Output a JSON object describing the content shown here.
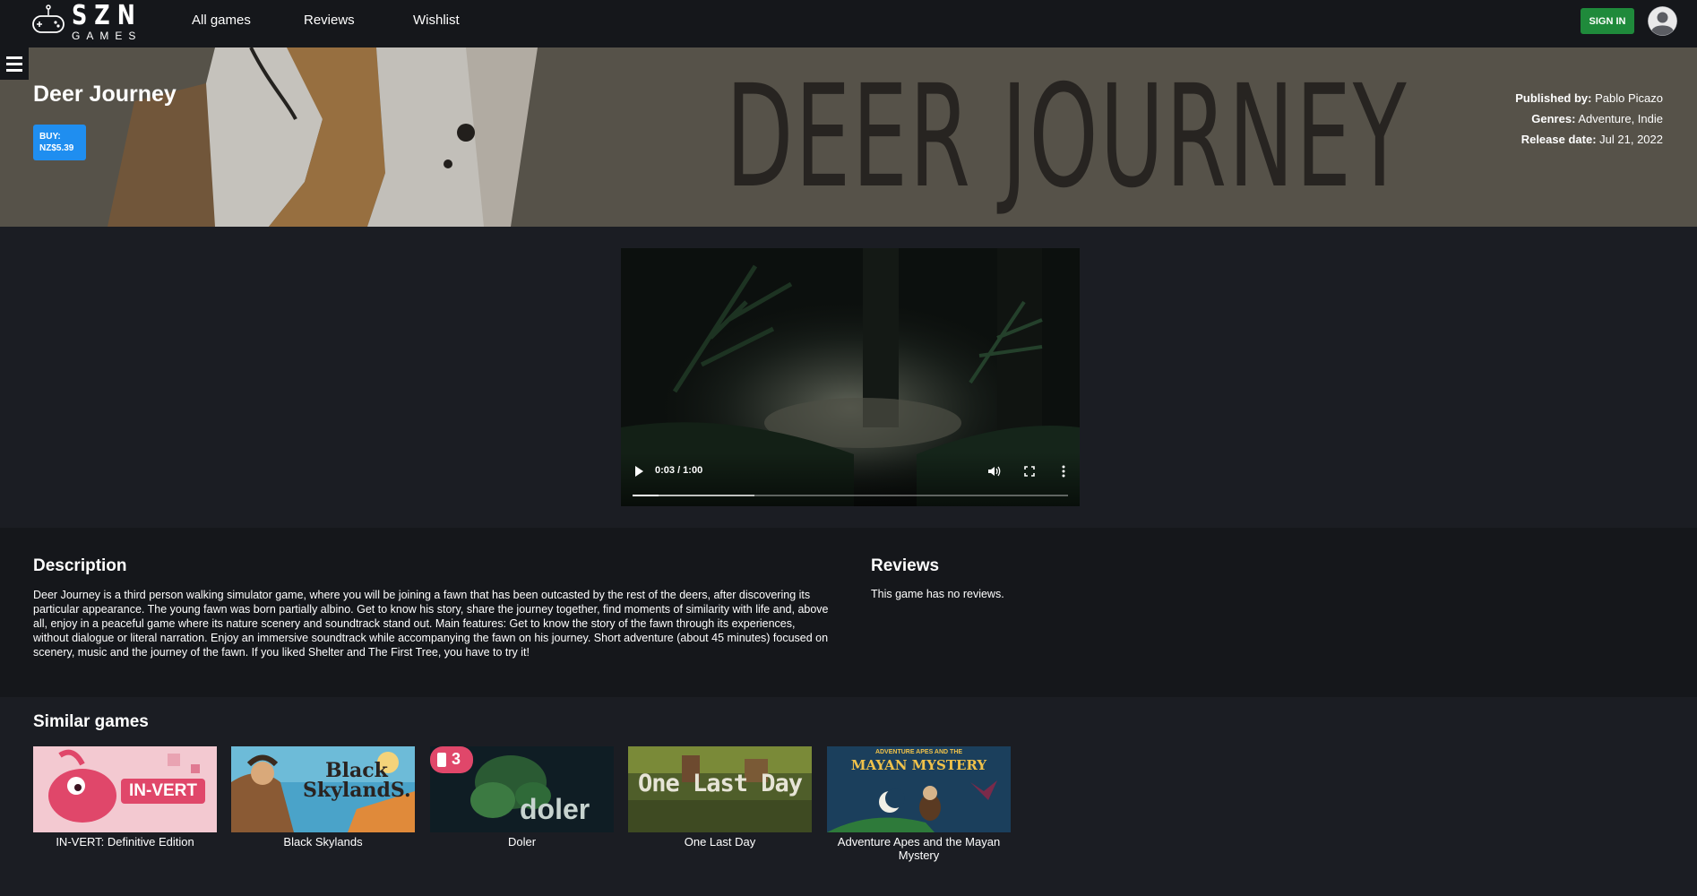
{
  "nav": {
    "logo_text": "SZN",
    "logo_sub": "GAMES",
    "links": [
      "All games",
      "Reviews",
      "Wishlist"
    ],
    "sign_in": "SIGN IN"
  },
  "hero": {
    "title": "Deer Journey",
    "buy_line1": "BUY:",
    "buy_line2": "NZ$5.39",
    "banner_text": "DEER JOURNEY",
    "published_label": "Published by:",
    "published_value": "Pablo Picazo",
    "genres_label": "Genres:",
    "genres_value": "Adventure, Indie",
    "release_label": "Release date:",
    "release_value": "Jul 21, 2022"
  },
  "video": {
    "time": "0:03 / 1:00",
    "progress": 0.06,
    "buffered": 0.28
  },
  "description": {
    "heading": "Description",
    "text": "Deer Journey is a third person walking simulator game, where you will be joining a fawn that has been outcasted by the rest of the deers, after discovering its particular appearance. The young fawn was born partially albino. Get to know his story, share the journey together, find moments of similarity with life and, above all, enjoy in a peaceful game where its nature scenery and soundtrack stand out. Main features: Get to know the story of the fawn through its experiences, without dialogue or literal narration. Enjoy an immersive soundtrack while accompanying the fawn on his journey. Short adventure (about 45 minutes) focused on scenery, music and the journey of the fawn. If you liked Shelter and The First Tree, you have to try it!"
  },
  "reviews": {
    "heading": "Reviews",
    "empty": "This game has no reviews."
  },
  "similar": {
    "heading": "Similar games",
    "games": [
      {
        "title": "IN-VERT: Definitive Edition",
        "art": "IN-VERT"
      },
      {
        "title": "Black Skylands",
        "art_line1": "Black",
        "art_line2": "SkylandS."
      },
      {
        "title": "Doler",
        "art": "doler",
        "badge": "3"
      },
      {
        "title": "One Last Day",
        "art": "One Last Day"
      },
      {
        "title": "Adventure Apes and the Mayan Mystery",
        "art_small": "ADVENTURE APES AND THE",
        "art": "MAYAN MYSTERY"
      }
    ]
  },
  "colors": {
    "nav_bg": "#15171b",
    "page_bg": "#1b1d23",
    "sign_in": "#1f8a3b",
    "buy": "#1f8ef0"
  },
  "icons": [
    "controller-icon",
    "user-avatar-icon",
    "hamburger-menu-icon",
    "play-icon",
    "volume-icon",
    "fullscreen-icon",
    "more-options-icon"
  ]
}
